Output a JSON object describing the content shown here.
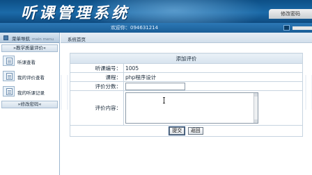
{
  "app": {
    "title": "听课管理系统",
    "top_tab": "修改密码"
  },
  "welcome": {
    "text": "欢迎你：094631214"
  },
  "sidebar": {
    "title": "菜单导航",
    "title_en": "main menu",
    "sections": [
      {
        "label": "»教学质量评价«",
        "items": [
          {
            "label": "听课查看",
            "icon": "document-icon"
          },
          {
            "label": "我的评价查看",
            "icon": "document-icon"
          },
          {
            "label": "我的听课记录",
            "icon": "document-icon"
          }
        ]
      },
      {
        "label": "»修改密码«",
        "items": []
      }
    ]
  },
  "breadcrumb": {
    "text": "系统首页"
  },
  "form": {
    "title": "添加评价",
    "lesson_id_label": "听课编号：",
    "lesson_id_value": "1005",
    "course_label": "课程：",
    "course_value": "php程序设计",
    "score_label": "评价分数：",
    "score_value": "",
    "content_label": "评价内容：",
    "content_value": "",
    "submit_label": "提交",
    "back_label": "返回"
  },
  "colors": {
    "banner": "#1b6aa8",
    "sidebar_header": "#c6d7e8",
    "border": "#c7d4e0"
  }
}
